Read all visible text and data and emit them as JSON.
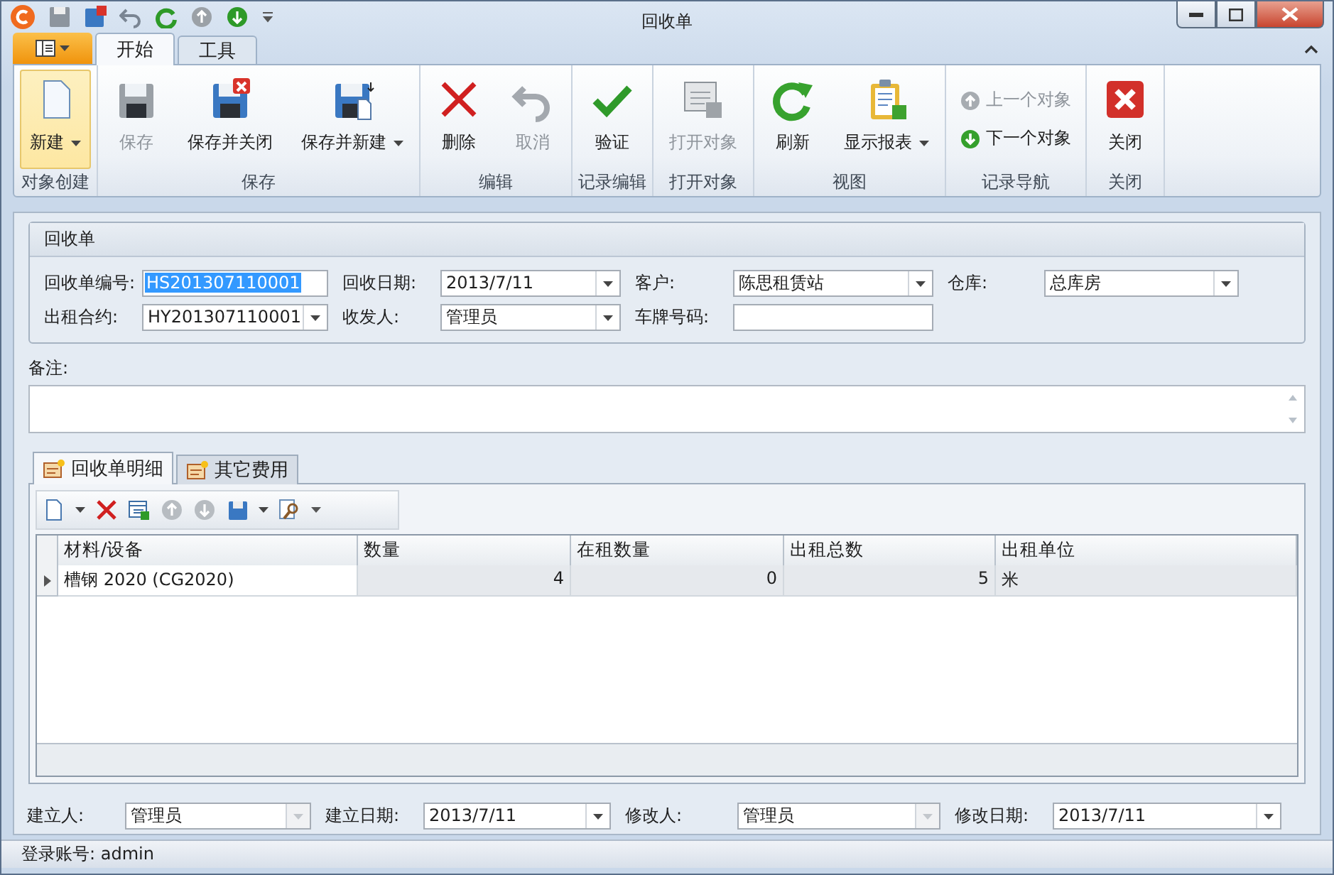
{
  "window": {
    "title": "回收单"
  },
  "ribbon_tabs": [
    {
      "label": "开始",
      "selected": true
    },
    {
      "label": "工具",
      "selected": false
    }
  ],
  "ribbon_groups": [
    {
      "label": "对象创建",
      "buttons": [
        {
          "label": "新建",
          "kind": "large",
          "dropdown": true,
          "disabled": false,
          "highlighted": true
        }
      ]
    },
    {
      "label": "保存",
      "buttons": [
        {
          "label": "保存",
          "kind": "large",
          "dropdown": false,
          "disabled": true,
          "highlighted": false
        },
        {
          "label": "保存并关闭",
          "kind": "large",
          "dropdown": false,
          "disabled": false,
          "highlighted": false
        },
        {
          "label": "保存并新建",
          "kind": "large",
          "dropdown": true,
          "disabled": false,
          "highlighted": false
        }
      ]
    },
    {
      "label": "编辑",
      "buttons": [
        {
          "label": "删除",
          "kind": "large",
          "dropdown": false,
          "disabled": false,
          "highlighted": false
        },
        {
          "label": "取消",
          "kind": "large",
          "dropdown": false,
          "disabled": true,
          "highlighted": false
        }
      ]
    },
    {
      "label": "记录编辑",
      "buttons": [
        {
          "label": "验证",
          "kind": "large",
          "dropdown": false,
          "disabled": false,
          "highlighted": false
        }
      ]
    },
    {
      "label": "打开对象",
      "buttons": [
        {
          "label": "打开对象",
          "kind": "large",
          "dropdown": false,
          "disabled": true,
          "highlighted": false
        }
      ]
    },
    {
      "label": "视图",
      "buttons": [
        {
          "label": "刷新",
          "kind": "large",
          "dropdown": false,
          "disabled": false,
          "highlighted": false
        },
        {
          "label": "显示报表",
          "kind": "large",
          "dropdown": true,
          "disabled": false,
          "highlighted": false
        }
      ]
    },
    {
      "label": "记录导航",
      "buttons": [
        {
          "label": "上一个对象",
          "kind": "small",
          "disabled": true
        },
        {
          "label": "下一个对象",
          "kind": "small",
          "disabled": false
        }
      ]
    },
    {
      "label": "关闭",
      "buttons": [
        {
          "label": "关闭",
          "kind": "large",
          "dropdown": false,
          "disabled": false,
          "highlighted": false
        }
      ]
    }
  ],
  "form": {
    "title": "回收单",
    "rows": [
      [
        {
          "label": "回收单编号:",
          "kind": "text",
          "value": "HS201307110001",
          "highlighted": true
        },
        {
          "label": "回收日期:",
          "kind": "combo",
          "value": "2013/7/11"
        },
        {
          "label": "客户:",
          "kind": "combo",
          "value": "陈思租赁站"
        },
        {
          "label": "仓库:",
          "kind": "combo",
          "value": "总库房"
        }
      ],
      [
        {
          "label": "出租合约:",
          "kind": "combo",
          "value": "HY201307110001"
        },
        {
          "label": "收发人:",
          "kind": "combo",
          "value": "管理员"
        },
        {
          "label": "车牌号码:",
          "kind": "text"
        }
      ]
    ]
  },
  "note": {
    "label": "备注:"
  },
  "detail_tabs": [
    {
      "label": "回收单明细",
      "selected": true
    },
    {
      "label": "其它费用",
      "selected": false
    }
  ],
  "table": {
    "columns": [
      "材料/设备",
      "数量",
      "在租数量",
      "出租总数",
      "出租单位"
    ],
    "rows": [
      {
        "selected": true,
        "cells": [
          "槽钢 2020 (CG2020)",
          "4",
          "0",
          "5",
          "米"
        ]
      }
    ]
  },
  "footer_fields": [
    {
      "label": "建立人:",
      "value": "管理员",
      "disabled": true
    },
    {
      "label": "建立日期:",
      "value": "2013/7/11",
      "disabled": false
    },
    {
      "label": "修改人:",
      "value": "管理员",
      "disabled": true
    },
    {
      "label": "修改日期:",
      "value": "2013/7/11",
      "disabled": false
    }
  ],
  "status_bar": {
    "text": "登录账号: admin"
  }
}
